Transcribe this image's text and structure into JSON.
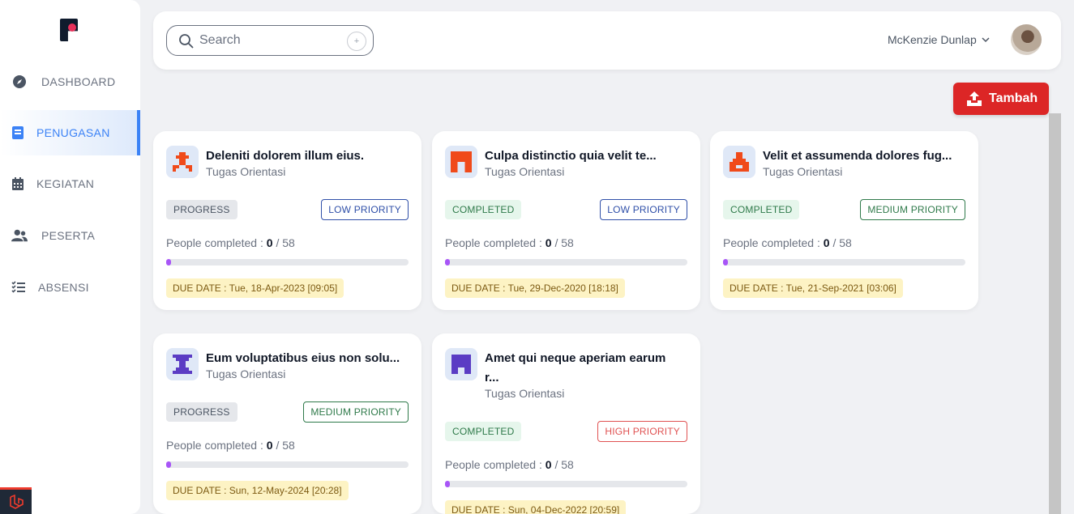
{
  "sidebar": {
    "items": [
      {
        "label": "DASHBOARD",
        "icon": "compass-icon"
      },
      {
        "label": "PENUGASAN",
        "icon": "book-icon"
      },
      {
        "label": "KEGIATAN",
        "icon": "calendar-icon"
      },
      {
        "label": "PESERTA",
        "icon": "users-icon"
      },
      {
        "label": "ABSENSI",
        "icon": "checklist-icon"
      }
    ]
  },
  "header": {
    "search_placeholder": "Search",
    "search_shortcut": "+",
    "user_name": "McKenzie Dunlap"
  },
  "actions": {
    "add_label": "Tambah"
  },
  "colors": {
    "accent": "#3b82f6",
    "danger": "#dc2626",
    "progress": "#a855f7"
  },
  "cards": [
    {
      "title": "Deleniti dolorem illum eius.",
      "subtitle": "Tugas Orientasi",
      "status": "PROGRESS",
      "priority": "LOW PRIORITY",
      "people_label": "People completed : ",
      "completed": "0",
      "total": "/ 58",
      "progress": 0,
      "due": "DUE DATE : Tue, 18-Apr-2023 [09:05]"
    },
    {
      "title": "Culpa distinctio quia velit te...",
      "subtitle": "Tugas Orientasi",
      "status": "COMPLETED",
      "priority": "LOW PRIORITY",
      "people_label": "People completed : ",
      "completed": "0",
      "total": "/ 58",
      "progress": 0,
      "due": "DUE DATE : Tue, 29-Dec-2020 [18:18]"
    },
    {
      "title": "Velit et assumenda dolores fug...",
      "subtitle": "Tugas Orientasi",
      "status": "COMPLETED",
      "priority": "MEDIUM PRIORITY",
      "people_label": "People completed : ",
      "completed": "0",
      "total": "/ 58",
      "progress": 0,
      "due": "DUE DATE : Tue, 21-Sep-2021 [03:06]"
    },
    {
      "title": "Eum voluptatibus eius non solu...",
      "subtitle": "Tugas Orientasi",
      "status": "PROGRESS",
      "priority": "MEDIUM PRIORITY",
      "people_label": "People completed : ",
      "completed": "0",
      "total": "/ 58",
      "progress": 0,
      "due": "DUE DATE : Sun, 12-May-2024 [20:28]"
    },
    {
      "title": "Amet qui neque aperiam earum r...",
      "subtitle": "Tugas Orientasi",
      "status": "COMPLETED",
      "priority": "HIGH PRIORITY",
      "people_label": "People completed : ",
      "completed": "0",
      "total": "/ 58",
      "progress": 0,
      "due": "DUE DATE : Sun, 04-Dec-2022 [20:59]"
    }
  ]
}
